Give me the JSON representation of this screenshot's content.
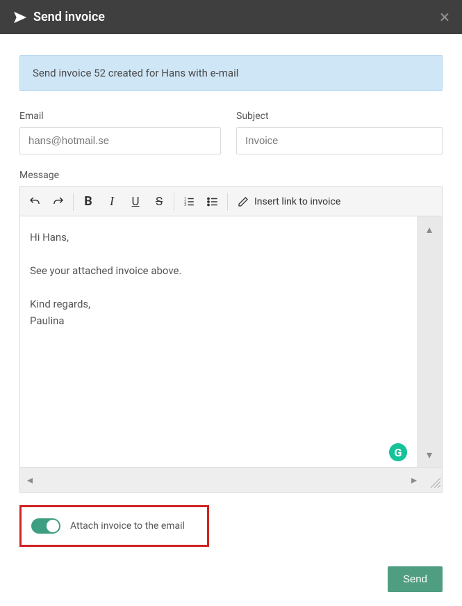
{
  "header": {
    "title": "Send invoice"
  },
  "banner": {
    "text": "Send invoice 52 created for Hans with e-mail"
  },
  "form": {
    "email_label": "Email",
    "email_value": "hans@hotmail.se",
    "subject_label": "Subject",
    "subject_value": "Invoice",
    "message_label": "Message"
  },
  "toolbar": {
    "undo": "↶",
    "redo": "↷",
    "bold": "B",
    "italic": "I",
    "underline": "U",
    "strike": "S",
    "insert_link_label": "Insert link to invoice"
  },
  "message_body": "Hi Hans,\n\nSee your attached invoice above.\n\nKind regards,\nPaulina",
  "attach": {
    "label": "Attach invoice to the email",
    "on": true
  },
  "buttons": {
    "send": "Send"
  },
  "icons": {
    "grammarly": "G"
  }
}
